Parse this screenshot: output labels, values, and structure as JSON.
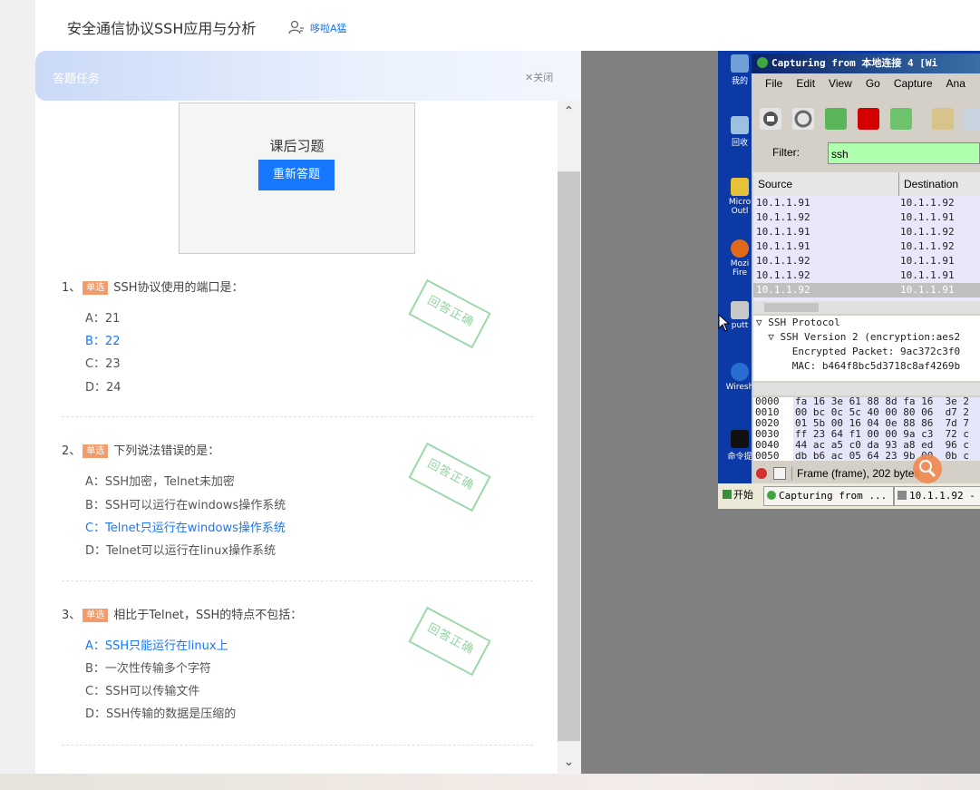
{
  "header": {
    "title": "安全通信协议SSH应用与分析",
    "user": "哆啦A猛"
  },
  "panel": {
    "title": "答题任务",
    "close": "✕关闭",
    "scroll_up": "⌃",
    "scroll_down": "⌄"
  },
  "card": {
    "title": "课后习题",
    "button": "重新答题"
  },
  "badge": "单选",
  "stamp": "回答正确",
  "questions": [
    {
      "number": "1、",
      "text": "SSH协议使用的端口是：",
      "options": [
        "A：21",
        "B：22",
        "C：23",
        "D：24"
      ],
      "selected": 1
    },
    {
      "number": "2、",
      "text": "下列说法错误的是：",
      "options": [
        "A：SSH加密，Telnet未加密",
        "B：SSH可以运行在windows操作系统",
        "C：Telnet只运行在windows操作系统",
        "D：Telnet可以运行在linux操作系统"
      ],
      "selected": 2
    },
    {
      "number": "3、",
      "text": "相比于Telnet，SSH的特点不包括：",
      "options": [
        "A：SSH只能运行在linux上",
        "B：一次性传输多个字符",
        "C：SSH可以传输文件",
        "D：SSH传输的数据是压缩的"
      ],
      "selected": 0
    }
  ],
  "desktop": {
    "icons": [
      "我的",
      "回收",
      "Micro Outl",
      "Mozi Fire",
      "putt",
      "Wiresh",
      "命令提"
    ],
    "wireshark": {
      "title": "Capturing from 本地连接 4  [Wi",
      "menu": [
        "File",
        "Edit",
        "View",
        "Go",
        "Capture",
        "Ana"
      ],
      "filter_label": "Filter:",
      "filter_value": "ssh",
      "columns": [
        "Source",
        "Destination"
      ],
      "packets": [
        [
          "10.1.1.91",
          "10.1.1.92"
        ],
        [
          "10.1.1.92",
          "10.1.1.91"
        ],
        [
          "10.1.1.91",
          "10.1.1.92"
        ],
        [
          "10.1.1.91",
          "10.1.1.92"
        ],
        [
          "10.1.1.92",
          "10.1.1.91"
        ],
        [
          "10.1.1.92",
          "10.1.1.91"
        ],
        [
          "10.1.1.92",
          "10.1.1.91"
        ]
      ],
      "selected_packet": 6,
      "detail": [
        "▽ SSH Protocol",
        "  ▽ SSH Version 2 (encryption:aes2",
        "      Encrypted Packet: 9ac372c3f0",
        "      MAC: b464f8bc5d3718c8af4269b"
      ],
      "hex_offsets": [
        "0000",
        "0010",
        "0020",
        "0030",
        "0040",
        "0050"
      ],
      "hex_bytes": [
        "fa 16 3e 61 88 8d fa 16  3e 2",
        "00 bc 0c 5c 40 00 80 06  d7 2",
        "01 5b 00 16 04 0e 88 86  7d 7",
        "ff 23 64 f1 00 00 9a c3  72 c",
        "44 ac a5 c0 da 93 a8 ed  96 c",
        "db b6 ac 05 64 23 9b 00  0b c"
      ],
      "status": "Frame (frame), 202 bytes"
    },
    "taskbar": {
      "start": "开始",
      "task1": "Capturing from ...",
      "task2": "10.1.1.92 -"
    }
  }
}
